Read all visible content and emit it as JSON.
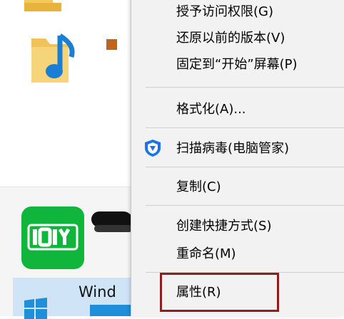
{
  "background": {
    "app_tile_text": "Wind"
  },
  "context_menu": {
    "items": [
      {
        "label": "授予访问权限(G)"
      },
      {
        "label": "还原以前的版本(V)"
      },
      {
        "label": "固定到“开始”屏幕(P)"
      },
      {
        "label": "格式化(A)..."
      },
      {
        "label": "扫描病毒(电脑管家)",
        "icon": "shield-icon"
      },
      {
        "label": "复制(C)"
      },
      {
        "label": "创建快捷方式(S)"
      },
      {
        "label": "重命名(M)"
      },
      {
        "label": "属性(R)"
      }
    ]
  },
  "colors": {
    "highlight_border": "#8e1f1f",
    "menu_background": "#f2f2f2",
    "iqiyi_green": "#10b53c",
    "shield_blue": "#1a73e8"
  }
}
